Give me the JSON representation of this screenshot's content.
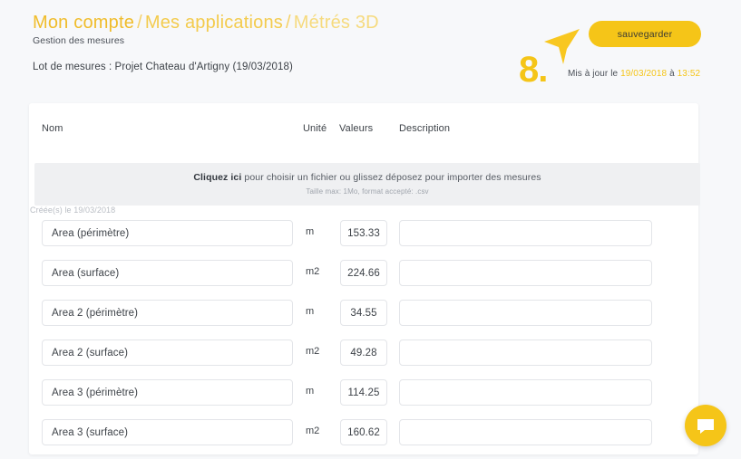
{
  "header": {
    "breadcrumb": {
      "part1": "Mon compte",
      "sep1": "/",
      "part2": "Mes applications",
      "sep2": "/",
      "part3": "Métrés 3D"
    },
    "subtitle": "Gestion des mesures",
    "lot_line": "Lot de mesures : Projet Chateau d'Artigny (19/03/2018)",
    "save_label": "sauvegarder",
    "step_number": "8.",
    "updated": {
      "prefix": "Mis à jour le",
      "date": "19/03/2018",
      "middle": "à",
      "time": "13:52"
    }
  },
  "table": {
    "columns": {
      "name": "Nom",
      "unit": "Unité",
      "values": "Valeurs",
      "description": "Description"
    },
    "dropzone": {
      "link": "Cliquez ici",
      "text": " pour choisir un fichier ou glissez déposez pour importer des mesures",
      "hint": "Taille max: 1Mo, format accepté: .csv"
    },
    "created_label": "Créée(s) le 19/03/2018",
    "rows": [
      {
        "name": "Area (périmètre)",
        "unit": "m",
        "value": "153.33",
        "description": ""
      },
      {
        "name": "Area (surface)",
        "unit": "m2",
        "value": "224.66",
        "description": ""
      },
      {
        "name": "Area 2 (périmètre)",
        "unit": "m",
        "value": "34.55",
        "description": ""
      },
      {
        "name": "Area 2 (surface)",
        "unit": "m2",
        "value": "49.28",
        "description": ""
      },
      {
        "name": "Area 3 (périmètre)",
        "unit": "m",
        "value": "114.25",
        "description": ""
      },
      {
        "name": "Area 3 (surface)",
        "unit": "m2",
        "value": "160.62",
        "description": ""
      }
    ]
  },
  "widgets": {
    "chat_icon": "chat-bubble-icon"
  },
  "colors": {
    "accent": "#f5c518",
    "page_bg": "#f7f8fa",
    "card_bg": "#ffffff",
    "dropzone_bg": "#eff0f2",
    "text": "#3d4248"
  }
}
